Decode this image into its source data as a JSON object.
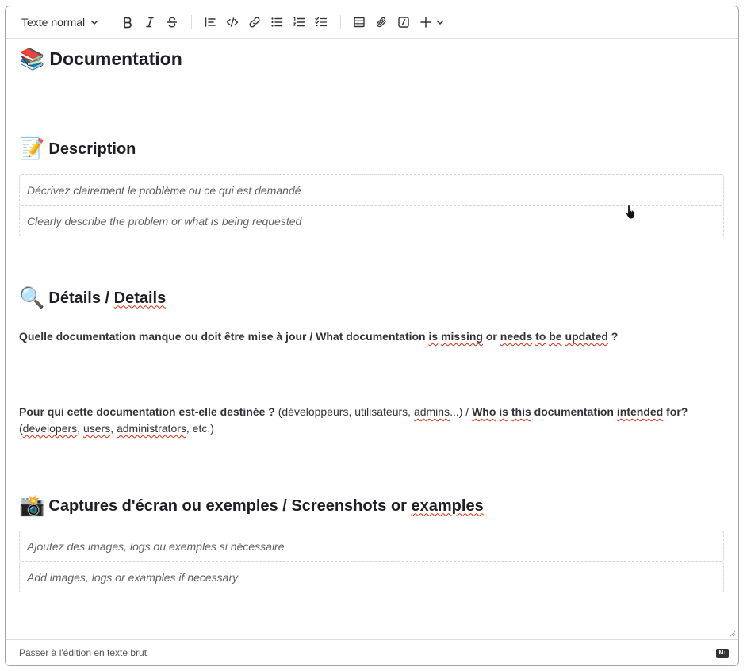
{
  "toolbar": {
    "text_style": "Texte normal",
    "buttons": [
      "bold-icon",
      "italic-icon",
      "strikethrough-icon",
      "blockquote-icon",
      "code-icon",
      "link-icon",
      "bullet-list-icon",
      "numbered-list-icon",
      "task-list-icon",
      "table-icon",
      "attachment-icon",
      "slash-command-icon",
      "plus-icon"
    ]
  },
  "doc": {
    "title_emoji": "📚",
    "title": "Documentation",
    "description": {
      "emoji": "📝",
      "heading": "Description",
      "placeholder_fr": "Décrivez clairement le problème ou ce qui est demandé",
      "placeholder_en": "Clearly describe the problem or what is being requested"
    },
    "details": {
      "emoji": "🔍",
      "heading_a": "Détails / ",
      "heading_b": "Details",
      "q1_a": "Quelle documentation manque ou doit être mise à jour / What documentation ",
      "q1_b": "is",
      "q1_c": " ",
      "q1_d": "missing",
      "q1_e": " or ",
      "q1_f": "needs",
      "q1_g": " ",
      "q1_h": "to",
      "q1_i": " ",
      "q1_j": "be",
      "q1_k": " ",
      "q1_l": "updated",
      "q1_m": " ?",
      "q2_bold_a": "Pour qui cette documentation est-elle destinée ?",
      "q2_plain_a": " (développeurs, utilisateurs, ",
      "q2_plain_b": "admins",
      "q2_plain_c": "...) / ",
      "q2_bold_b": "Who",
      "q2_bold_c": " ",
      "q2_bold_d": "is",
      "q2_bold_e": " ",
      "q2_bold_f": "this",
      "q2_bold_g": " documentation ",
      "q2_bold_h": "intended",
      "q2_bold_i": " for?",
      "q2_plain_d": "(",
      "q2_plain_e": "developers",
      "q2_plain_f": ", ",
      "q2_plain_g": "users",
      "q2_plain_h": ", ",
      "q2_plain_i": "administrators",
      "q2_plain_j": ", etc.)"
    },
    "screenshots": {
      "emoji": "📸",
      "heading_a": "Captures d'écran ou exemples / Screenshots or ",
      "heading_b": "examples",
      "placeholder_fr": "Ajoutez des images, logs ou exemples si nécessaire",
      "placeholder_en": "Add images, logs or examples if necessary"
    }
  },
  "footer": {
    "switch_label": "Passer à l'édition en texte brut",
    "md_badge": "M↓"
  }
}
